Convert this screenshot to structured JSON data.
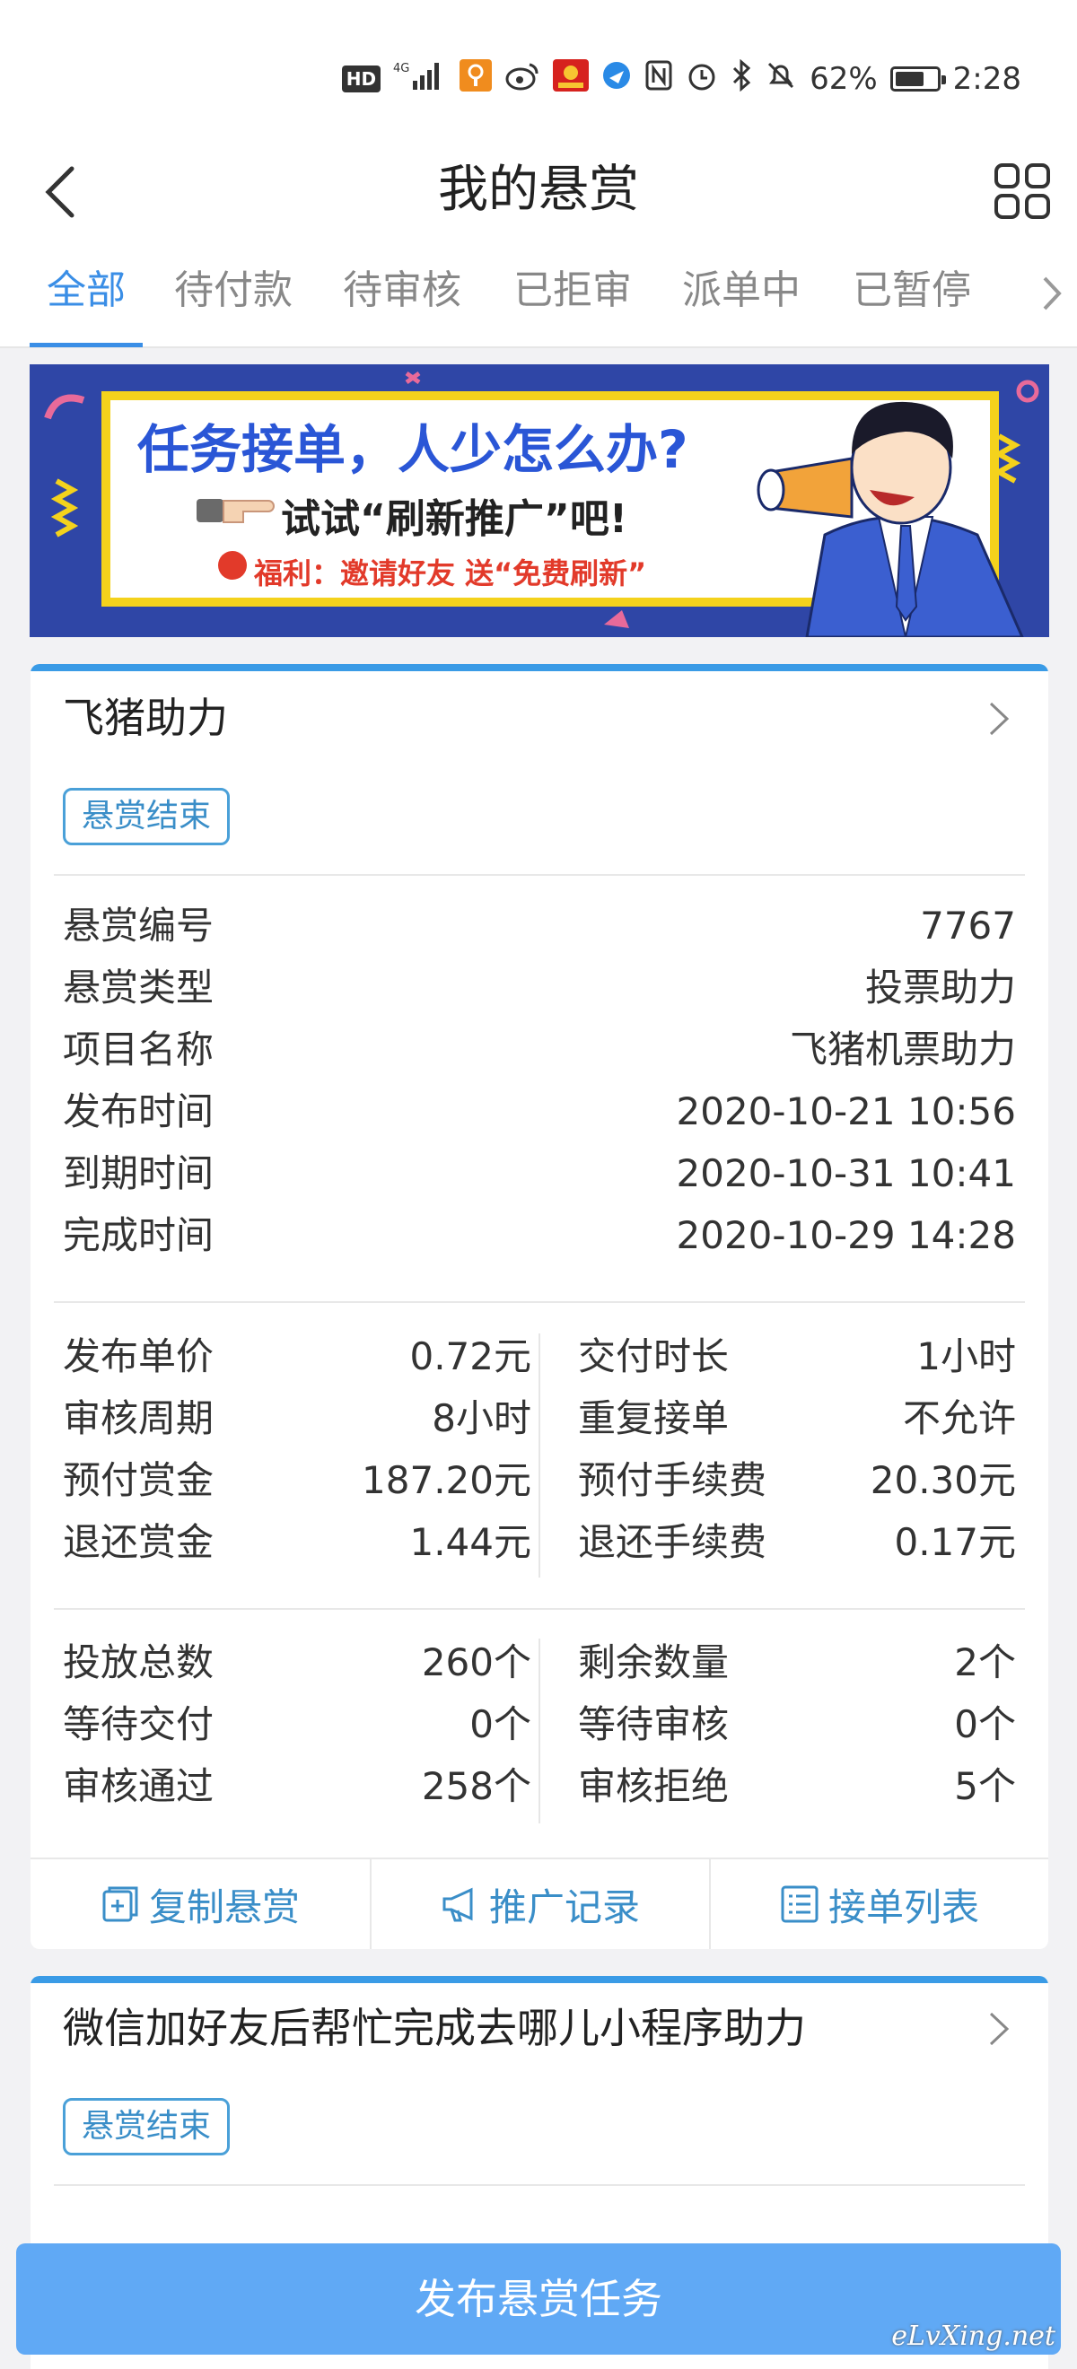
{
  "status_bar": {
    "hd": "HD",
    "network": "4G",
    "battery": "62%",
    "battery_level": 0.62,
    "time": "2:28"
  },
  "header": {
    "title": "我的悬赏"
  },
  "tabs": [
    {
      "label": "全部",
      "active": true
    },
    {
      "label": "待付款",
      "active": false
    },
    {
      "label": "待审核",
      "active": false
    },
    {
      "label": "已拒审",
      "active": false
    },
    {
      "label": "派单中",
      "active": false
    },
    {
      "label": "已暂停",
      "active": false
    }
  ],
  "banner": {
    "title": "任务接单，人少怎么办?",
    "subtitle": "试试“刷新推广”吧!",
    "welfare": "福利：邀请好友 送“免费刷新”"
  },
  "card1": {
    "name": "飞猪助力",
    "badge": "悬赏结束",
    "details": [
      {
        "label": "悬赏编号",
        "value": "7767"
      },
      {
        "label": "悬赏类型",
        "value": "投票助力"
      },
      {
        "label": "项目名称",
        "value": "飞猪机票助力"
      },
      {
        "label": "发布时间",
        "value": "2020-10-21 10:56"
      },
      {
        "label": "到期时间",
        "value": "2020-10-31 10:41"
      },
      {
        "label": "完成时间",
        "value": "2020-10-29 14:28"
      }
    ],
    "fees_left": [
      {
        "label": "发布单价",
        "value": "0.72元"
      },
      {
        "label": "审核周期",
        "value": "8小时"
      },
      {
        "label": "预付赏金",
        "value": "187.20元"
      },
      {
        "label": "退还赏金",
        "value": "1.44元"
      }
    ],
    "fees_right": [
      {
        "label": "交付时长",
        "value": "1小时"
      },
      {
        "label": "重复接单",
        "value": "不允许"
      },
      {
        "label": "预付手续费",
        "value": "20.30元"
      },
      {
        "label": "退还手续费",
        "value": "0.17元"
      }
    ],
    "counts_left": [
      {
        "label": "投放总数",
        "value": "260个"
      },
      {
        "label": "等待交付",
        "value": "0个"
      },
      {
        "label": "审核通过",
        "value": "258个"
      }
    ],
    "counts_right": [
      {
        "label": "剩余数量",
        "value": "2个"
      },
      {
        "label": "等待审核",
        "value": "0个"
      },
      {
        "label": "审核拒绝",
        "value": "5个"
      }
    ],
    "actions": {
      "copy": "复制悬赏",
      "promote": "推广记录",
      "orders": "接单列表"
    }
  },
  "card2": {
    "name": "微信加好友后帮忙完成去哪儿小程序助力",
    "badge": "悬赏结束"
  },
  "publish_button": "发布悬赏任务",
  "watermark": "eLvXing.net",
  "colors": {
    "accent": "#3a8ee6",
    "badge_border": "#4aa0d8",
    "publish_bg": "#5aa6f5",
    "banner_bg": "#2f46a6",
    "banner_frame": "#f4d21c"
  }
}
